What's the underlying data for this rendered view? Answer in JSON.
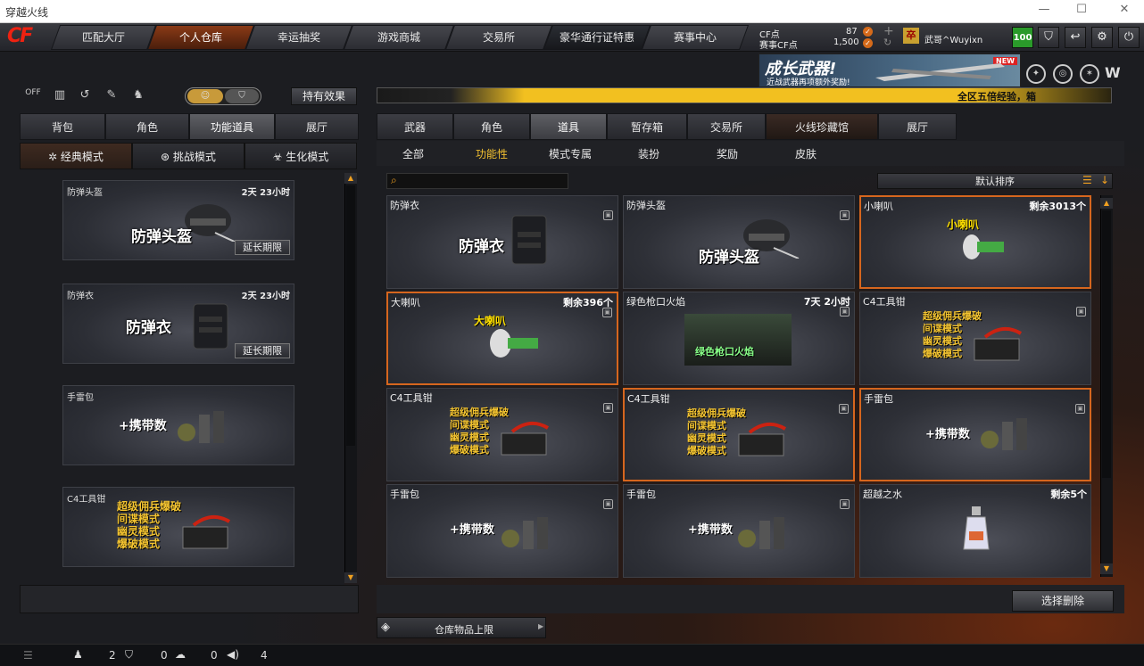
{
  "window": {
    "title": "穿越火线",
    "minimize": "—",
    "maximize": "☐",
    "close": "✕"
  },
  "nav": {
    "tabs": [
      "匹配大厅",
      "个人仓库",
      "幸运抽奖",
      "游戏商城",
      "交易所",
      "豪华通行证特惠",
      "赛事中心"
    ],
    "active": 1
  },
  "account": {
    "cf_label": "CF点",
    "cf_value": "87",
    "match_label": "赛事CF点",
    "match_value": "1,500",
    "rank_badge": "卒",
    "name": "武哥^Wuyixn",
    "level": "100"
  },
  "banner": {
    "title": "成长武器!",
    "subtitle": "近战武器再项额外奖励!",
    "new": "NEW"
  },
  "ticker": "全区五倍经验，箱",
  "left": {
    "toggle_on": "OFF",
    "effect_button": "持有效果",
    "tabs": [
      "背包",
      "角色",
      "功能道具",
      "展厅"
    ],
    "active_tab": 2,
    "modes": [
      "经典模式",
      "挑战模式",
      "生化模式"
    ],
    "active_mode": 0,
    "cards": [
      {
        "name": "防弹头盔",
        "time": "2天 23小时",
        "big": "防弹头盔",
        "extend": "延长期限"
      },
      {
        "name": "防弹衣",
        "time": "2天 23小时",
        "big": "防弹衣",
        "extend": "延长期限"
      },
      {
        "name": "手雷包",
        "time": "",
        "big": "+携带数",
        "extend": ""
      },
      {
        "name": "C4工具钳",
        "time": "",
        "modes": [
          "超级佣兵爆破",
          "间谍模式",
          "幽灵模式",
          "爆破模式"
        ]
      }
    ]
  },
  "right": {
    "tabs": [
      "武器",
      "角色",
      "道具",
      "暂存箱",
      "交易所",
      "火线珍藏馆",
      "展厅"
    ],
    "active_tab": 2,
    "subtabs": [
      "全部",
      "功能性",
      "模式专属",
      "装扮",
      "奖励",
      "皮肤"
    ],
    "active_sub": 1,
    "search_placeholder": "",
    "sort": "默认排序",
    "grid": [
      {
        "name": "防弹衣",
        "right": "",
        "label": "防弹衣",
        "sel": false
      },
      {
        "name": "防弹头盔",
        "right": "",
        "label": "防弹头盔",
        "sel": false
      },
      {
        "name": "小喇叭",
        "right": "剩余3013个",
        "label": "小喇叭",
        "sel": true
      },
      {
        "name": "大喇叭",
        "right": "剩余396个",
        "label": "大喇叭",
        "sel": true
      },
      {
        "name": "绿色枪口火焰",
        "right": "7天 2小时",
        "label": "绿色枪口火焰",
        "sel": false
      },
      {
        "name": "C4工具钳",
        "right": "",
        "label": "",
        "sel": false
      },
      {
        "name": "C4工具钳",
        "right": "",
        "label": "",
        "sel": false
      },
      {
        "name": "C4工具钳",
        "right": "",
        "label": "",
        "sel": true
      },
      {
        "name": "手雷包",
        "right": "",
        "label": "+携带数",
        "sel": true
      },
      {
        "name": "手雷包",
        "right": "",
        "label": "+携带数",
        "sel": false
      },
      {
        "name": "手雷包",
        "right": "",
        "label": "+携带数",
        "sel": false
      },
      {
        "name": "超越之水",
        "right": "剩余5个",
        "label": "",
        "sel": false
      }
    ],
    "c4_modes": [
      "超级佣兵爆破",
      "间谍模式",
      "幽灵模式",
      "爆破模式"
    ],
    "delete_button": "选择删除",
    "storage_limit": "仓库物品上限"
  },
  "status": {
    "c1": "2",
    "c2": "0",
    "c3": "0",
    "c4": "4"
  }
}
